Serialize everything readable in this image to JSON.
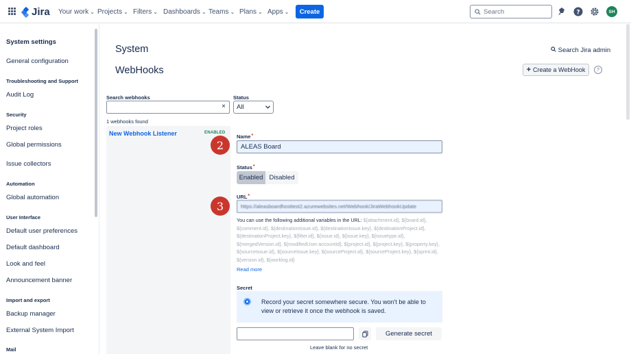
{
  "topnav": {
    "logo_text": "Jira",
    "items": [
      {
        "label": "Your work"
      },
      {
        "label": "Projects"
      },
      {
        "label": "Filters"
      },
      {
        "label": "Dashboards"
      },
      {
        "label": "Teams"
      },
      {
        "label": "Plans"
      },
      {
        "label": "Apps"
      }
    ],
    "create_label": "Create",
    "search_placeholder": "Search",
    "avatar_initials": "SH",
    "brand_color": "#0c66e4"
  },
  "sidebar": {
    "title": "System settings",
    "entries": [
      {
        "kind": "item",
        "label": "General configuration"
      },
      {
        "kind": "section",
        "label": "Troubleshooting and Support"
      },
      {
        "kind": "item",
        "label": "Audit Log"
      },
      {
        "kind": "section",
        "label": "Security"
      },
      {
        "kind": "item",
        "label": "Project roles"
      },
      {
        "kind": "item",
        "label": "Global permissions"
      },
      {
        "kind": "item",
        "label": "Issue collectors"
      },
      {
        "kind": "section",
        "label": "Automation"
      },
      {
        "kind": "item",
        "label": "Global automation"
      },
      {
        "kind": "section",
        "label": "User Interface"
      },
      {
        "kind": "item",
        "label": "Default user preferences"
      },
      {
        "kind": "item",
        "label": "Default dashboard"
      },
      {
        "kind": "item",
        "label": "Look and feel"
      },
      {
        "kind": "item",
        "label": "Announcement banner"
      },
      {
        "kind": "section",
        "label": "Import and export"
      },
      {
        "kind": "item",
        "label": "Backup manager"
      },
      {
        "kind": "item",
        "label": "External System Import"
      },
      {
        "kind": "section",
        "label": "Mail"
      }
    ]
  },
  "header": {
    "title": "System",
    "subtitle": "WebHooks",
    "search_admin": "Search Jira admin",
    "create_webhook": "Create a WebHook",
    "help": "?"
  },
  "filters": {
    "search_label": "Search webhooks",
    "search_value": "",
    "clear": "×",
    "status_label": "Status",
    "status_value": "All",
    "found": "1 webhooks found"
  },
  "list": {
    "items": [
      {
        "name": "New Webhook Listener",
        "badge": "ENABLED"
      }
    ]
  },
  "markers": {
    "name": "2",
    "url": "3"
  },
  "form": {
    "name_label": "Name",
    "name_value": "ALEAS Board",
    "status_label": "Status",
    "enabled_label": "Enabled",
    "disabled_label": "Disabled",
    "url_label": "URL",
    "url_value": "https://aleasboardhosttest2.azurewebsites.net/Webhook/JiraWebhookUpdate",
    "vars_intro": "You can use the following additional variables in the URL:",
    "variables": "${attachment.id}, ${board.id}, ${comment.id}, ${destinationIssue.id}, ${destinationIssue.key}, ${destinationProject.id}, ${destinationProject.key}, ${filter.id}, ${issue.id}, ${issue.key}, ${issuetype.id}, ${mergedVersion.id}, ${modifiedUser.accountId}, ${project.id}, ${project.key}, ${property.key}, ${sourceIssue.id}, ${sourceIssue.key}, ${sourceProject.id}, ${sourceProject.key}, ${sprint.id}, ${version.id}, ${worklog.id}",
    "read_more": "Read more",
    "secret_label": "Secret",
    "secret_info": "Record your secret somewhere secure. You won't be able to view or retrieve it once the webhook is saved.",
    "secret_value": "",
    "generate_label": "Generate secret",
    "blank_note": "Leave blank for no secret"
  }
}
